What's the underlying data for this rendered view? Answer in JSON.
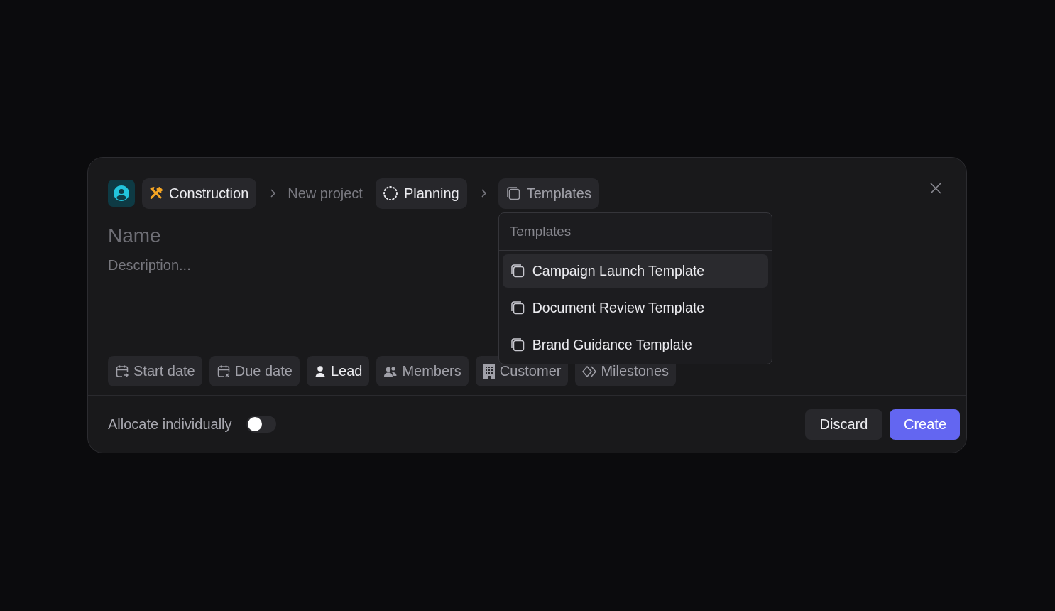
{
  "breadcrumb": {
    "team": "Construction",
    "page": "New project",
    "status": "Planning",
    "template": "Templates"
  },
  "name": {
    "placeholder": "Name"
  },
  "description": {
    "placeholder": "Description..."
  },
  "properties": [
    {
      "label": "Start date",
      "kind": "calendar",
      "set": false
    },
    {
      "label": "Due date",
      "kind": "calendarx",
      "set": false
    },
    {
      "label": "Lead",
      "kind": "person",
      "set": true
    },
    {
      "label": "Members",
      "kind": "people",
      "set": false
    },
    {
      "label": "Customer",
      "kind": "building",
      "set": false
    },
    {
      "label": "Milestones",
      "kind": "diamond",
      "set": false
    }
  ],
  "template_menu": {
    "title": "Templates",
    "items": [
      {
        "label": "Campaign Launch Template",
        "selected": true
      },
      {
        "label": "Document Review Template",
        "selected": false
      },
      {
        "label": "Brand Guidance Template",
        "selected": false
      }
    ]
  },
  "allocate": {
    "label": "Allocate individually",
    "on": false
  },
  "buttons": [
    {
      "label": "Discard",
      "kind": "secondary"
    },
    {
      "label": "Create",
      "kind": "primary"
    }
  ]
}
